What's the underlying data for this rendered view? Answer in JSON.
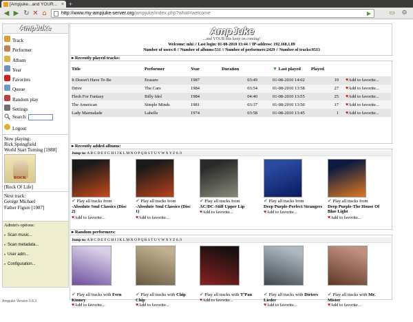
{
  "browser": {
    "tab_title": "[Ampjuke...and YOUR...",
    "tab_close": "×",
    "new_tab": "+",
    "url_host": "http://www.my-ampjuke-server.org",
    "url_path": "/ampjuke/index.php?what=welcome"
  },
  "sidebar": {
    "logo": "AmpJuke",
    "menu": [
      {
        "label": "Track",
        "icon": "track-icon",
        "color": "#d8a030"
      },
      {
        "label": "Performer",
        "icon": "performer-icon",
        "color": "#c08050"
      },
      {
        "label": "Album",
        "icon": "album-icon",
        "color": "#e0b040"
      },
      {
        "label": "Year",
        "icon": "calendar-icon",
        "color": "#7090c0"
      },
      {
        "label": "Favorites",
        "icon": "heart-icon",
        "color": "#d02020"
      },
      {
        "label": "Queue",
        "icon": "queue-icon",
        "color": "#6a9ad0"
      },
      {
        "label": "Random play",
        "icon": "dice-icon",
        "color": "#c04040"
      },
      {
        "label": "Settings",
        "icon": "settings-icon",
        "color": "#707070"
      }
    ],
    "search_label": "Search:",
    "logout_label": "Logout",
    "now_playing_label": "Now playing:",
    "now_playing_artist": "Rick Springfield",
    "now_playing_album": "World Start Turning [1988]",
    "now_playing_link": "[Rock Of Life]",
    "next_label": "Next track:",
    "next_artist": "George Michael",
    "next_title": "Father Figure [1987]",
    "admin_label": "Admin's options:",
    "admin_items": [
      "Scan music...",
      "Scan metadata...",
      "User adm...",
      "Configuration..."
    ],
    "version": "Ampjuke Version 0.8.3"
  },
  "main": {
    "logo": "AmpJuke",
    "tagline": "...and YOUR hits keep on coming!",
    "welcome": "Welcome: mhi // Last login: 01-08-2010 13:44 // IP-address: 192.168.1.89",
    "stats": "Number of users:8 // Number of albums:531 // Number of performers:2429 // Number of tracks:9513",
    "recent_tracks_head": "Recently played tracks:",
    "columns": [
      "Title",
      "Performer",
      "Year",
      "Duration",
      "Last played",
      "Played"
    ],
    "add_fav": "Add to favorite...",
    "tracks": [
      {
        "title": "It Doesn't Have To Be",
        "performer": "Erasure",
        "year": "1987",
        "duration": "03:49",
        "last": "01-08-2010 14:02",
        "played": "19"
      },
      {
        "title": "Drive",
        "performer": "The Cars",
        "year": "1984",
        "duration": "03:54",
        "last": "01-08-2010 13:58",
        "played": "27"
      },
      {
        "title": "Flesh For Fantasy",
        "performer": "Billy Idol",
        "year": "1984",
        "duration": "04:40",
        "last": "01-08-2010 13:55",
        "played": "25"
      },
      {
        "title": "The American",
        "performer": "Simple Minds",
        "year": "1981",
        "duration": "03:37",
        "last": "01-08-2010 13:50",
        "played": "17"
      },
      {
        "title": "Lady Marmalade",
        "performer": "Labelle",
        "year": "1974",
        "duration": "03:58",
        "last": "01-08-2010 13:45",
        "played": "1"
      }
    ],
    "recent_albums_head": "Recently added albums:",
    "jump_to": "Jump to:",
    "letters": "A B C D E F G H I J K L M N O P Q R S T U V W X Y Z 0..9",
    "play_all": "Play all tracks from",
    "albums": [
      {
        "name": "-Absolute Soul Classics (Disc 2)",
        "c1": "#1a1a1a",
        "c2": "#c84a18"
      },
      {
        "name": "-Absolute Soul Classics (Disc 1)",
        "c1": "#1a1a1a",
        "c2": "#b8421a"
      },
      {
        "name": "AC/DC-Stiff Upper Lip",
        "c1": "#2a2a2a",
        "c2": "#8a8a7a"
      },
      {
        "name": "Deep Purple-Perfect Strangers",
        "c1": "#2a4aa0",
        "c2": "#0a1a60"
      },
      {
        "name": "Deep Purple-The House Of Blue Light",
        "c1": "#0a1a40",
        "c2": "#e07a20"
      }
    ],
    "random_head": "Random performers:",
    "play_all_with": "Play all tracks with",
    "performers": [
      {
        "name": "Fern Kinney",
        "c1": "#d8d0e8",
        "c2": "#7050a0"
      },
      {
        "name": "Chip Chip",
        "c1": "#c0b090",
        "c2": "#6a5a40"
      },
      {
        "name": "T'Pau",
        "c1": "#1a1010",
        "c2": "#8a2020"
      },
      {
        "name": "Dieters Lieder",
        "c1": "#b0b8c0",
        "c2": "#404850"
      },
      {
        "name": "Mr. Mister",
        "c1": "#c09080",
        "c2": "#603828"
      }
    ]
  }
}
